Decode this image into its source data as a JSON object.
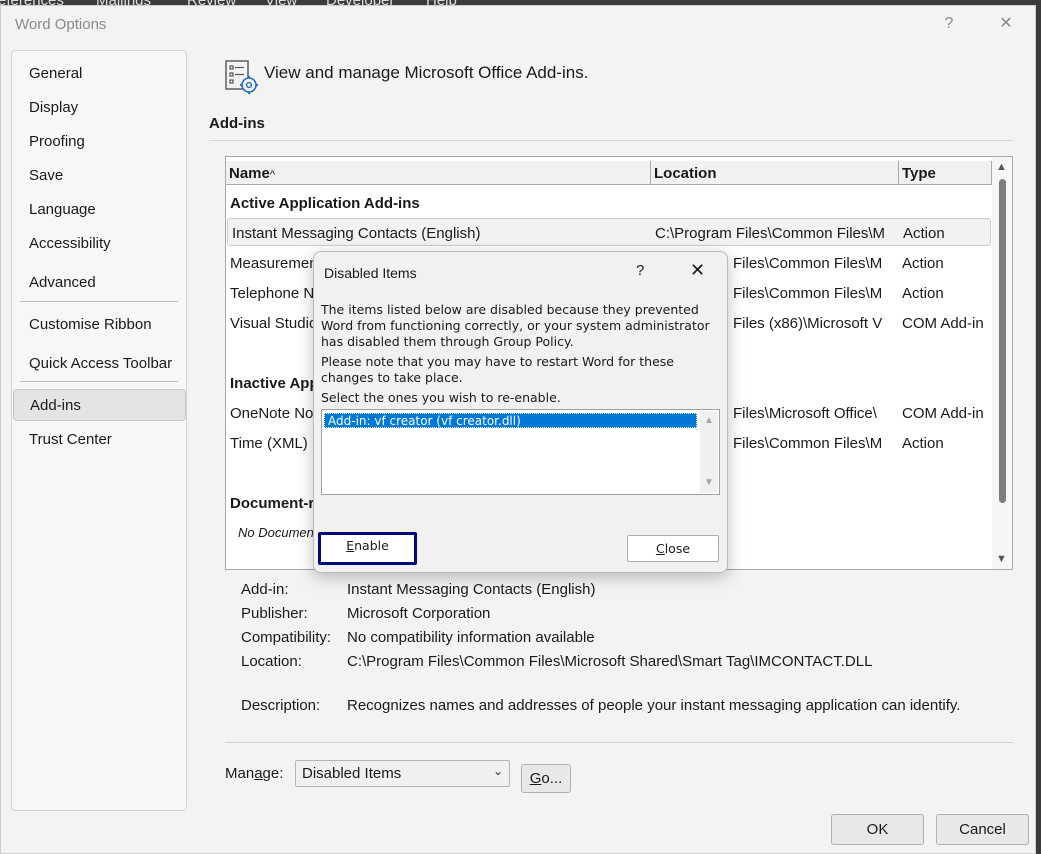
{
  "background_menu": [
    "eferences",
    "Mailings",
    "Review",
    "View",
    "Developer",
    "Help"
  ],
  "window": {
    "title": "Word Options",
    "help": "?",
    "close": "✕"
  },
  "nav": {
    "items": [
      {
        "label": "General"
      },
      {
        "label": "Display"
      },
      {
        "label": "Proofing"
      },
      {
        "label": "Save"
      },
      {
        "label": "Language"
      },
      {
        "label": "Accessibility"
      },
      {
        "label": "Advanced"
      },
      {
        "label": "Customise Ribbon"
      },
      {
        "label": "Quick Access Toolbar"
      },
      {
        "label": "Add-ins"
      },
      {
        "label": "Trust Center"
      }
    ],
    "selected": "Add-ins"
  },
  "main": {
    "header": "View and manage Microsoft Office Add-ins.",
    "section": "Add-ins",
    "columns": [
      "Name",
      "Location",
      "Type"
    ],
    "sort_indicator": "^",
    "rows": [
      {
        "name": "Active Application Add-ins",
        "location": "",
        "type": "",
        "group": true
      },
      {
        "name": "Instant Messaging Contacts (English)",
        "location": "C:\\Program Files\\Common Files\\M",
        "type": "Action",
        "selected": true
      },
      {
        "name": "Measuremen",
        "location": "Files\\Common Files\\M",
        "type": "Action"
      },
      {
        "name": "Telephone N",
        "location": "Files\\Common Files\\M",
        "type": "Action"
      },
      {
        "name": "Visual Studio",
        "location": "Files (x86)\\Microsoft V",
        "type": "COM Add-in"
      },
      {
        "name": "Inactive App",
        "location": "",
        "type": "",
        "group": true
      },
      {
        "name": "OneNote No",
        "location": "Files\\Microsoft Office\\",
        "type": "COM Add-in"
      },
      {
        "name": "Time (XML)",
        "location": "Files\\Common Files\\M",
        "type": "Action"
      },
      {
        "name": "Document-r",
        "location": "",
        "type": "",
        "group": true
      },
      {
        "name": "No Documen",
        "location": "",
        "type": "",
        "italic": true
      }
    ],
    "details": {
      "addin_label": "Add-in:",
      "addin_value": "Instant Messaging Contacts (English)",
      "publisher_label": "Publisher:",
      "publisher_value": "Microsoft Corporation",
      "compat_label": "Compatibility:",
      "compat_value": "No compatibility information available",
      "location_label": "Location:",
      "location_value": "C:\\Program Files\\Common Files\\Microsoft Shared\\Smart Tag\\IMCONTACT.DLL",
      "description_label": "Description:",
      "description_value": "Recognizes names and addresses of people your instant messaging application can identify."
    },
    "manage_label_prefix": "Man",
    "manage_label_underlined": "a",
    "manage_label_suffix": "ge:",
    "manage_selected": "Disabled Items",
    "go_label_underlined": "G",
    "go_label_rest": "o...",
    "ok_label": "OK",
    "cancel_label": "Cancel"
  },
  "dialog": {
    "title": "Disabled Items",
    "help": "?",
    "close": "✕",
    "text1": "The items listed below are disabled because they prevented Word from functioning correctly, or your system administrator has disabled them through Group Policy.",
    "text2": "Please note that you may have to restart Word for these changes to take place.",
    "text3": "Select the ones you wish to re-enable.",
    "list_items": [
      "Add-in: vf creator (vf creator.dll)"
    ],
    "enable_underlined": "E",
    "enable_rest": "nable",
    "close_underlined": "C",
    "close_rest": "lose"
  },
  "colors": {
    "selection": "#0078d7",
    "focus_border": "#000a78",
    "window_bg": "#f3f3f3"
  }
}
